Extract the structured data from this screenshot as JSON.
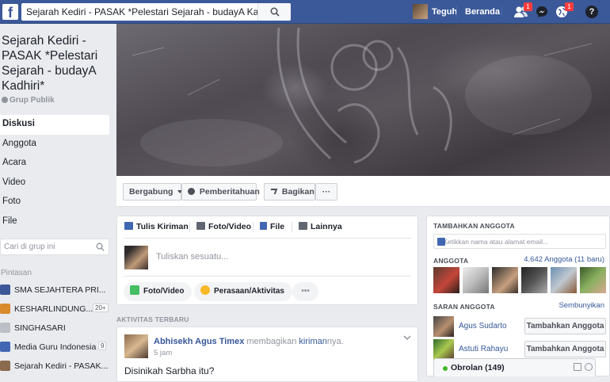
{
  "topbar": {
    "logo": "f",
    "search_value": "Sejarah Kediri - PASAK *Pelestari Sejarah - budayA Kadhiri*",
    "user_name": "Teguh",
    "home_label": "Beranda",
    "friend_requests_badge": "1",
    "notifications_badge": "1",
    "help_glyph": "?"
  },
  "sidebar": {
    "group_name": "Sejarah Kediri - PASAK *Pelestari Sejarah - budayA Kadhiri*",
    "group_privacy": "Grup Publik",
    "nav": [
      {
        "label": "Diskusi"
      },
      {
        "label": "Anggota"
      },
      {
        "label": "Acara"
      },
      {
        "label": "Video"
      },
      {
        "label": "Foto"
      },
      {
        "label": "File"
      }
    ],
    "search_placeholder": "Cari di grup ini",
    "shortcuts_title": "Pintasan",
    "shortcuts": [
      {
        "label": "SMA SEJAHTERA PRI...",
        "count": "",
        "icon": "group-icon",
        "color": "#3b5998"
      },
      {
        "label": "KESHARLINDUNG...",
        "count": "20+",
        "icon": "group-icon",
        "color": "#d98a2b"
      },
      {
        "label": "SINGHASARI",
        "count": "",
        "icon": "user-icon",
        "color": "#bcc0c6"
      },
      {
        "label": "Media Guru Indonesia",
        "count": "9",
        "icon": "book-icon",
        "color": "#4267b2"
      },
      {
        "label": "Sejarah Kediri - PASAK...",
        "count": "",
        "icon": "group-icon",
        "color": "#8a6b4e"
      }
    ]
  },
  "actions": {
    "join_label": "Bergabung",
    "notify_label": "Pemberitahuan",
    "share_label": "Bagikan",
    "more_label": "···"
  },
  "composer": {
    "tabs": [
      {
        "label": "Tulis Kiriman",
        "icon": "pencil-icon",
        "color": "#4267b2"
      },
      {
        "label": "Foto/Video",
        "icon": "camera-icon",
        "color": "#606770"
      },
      {
        "label": "File",
        "icon": "file-icon",
        "color": "#4267b2"
      },
      {
        "label": "Lainnya",
        "icon": "list-icon",
        "color": "#606770"
      }
    ],
    "placeholder": "Tuliskan sesuatu...",
    "buttons": [
      {
        "label": "Foto/Video",
        "color": "#45bd62"
      },
      {
        "label": "Perasaan/Aktivitas",
        "color": "#f7b928"
      }
    ],
    "more": "•••"
  },
  "activity": {
    "title": "AKTIVITAS TERBARU",
    "post": {
      "author": "Abhisekh Agus Timex",
      "verb": "membagikan",
      "object": "kiriman",
      "suffix": "nya.",
      "time": "5 jam",
      "text": "Disinikah Sarbha itu?"
    }
  },
  "right": {
    "add_title": "TAMBAHKAN ANGGOTA",
    "add_placeholder": "+ Ketikkan nama atau alamat email...",
    "members_title": "ANGGOTA",
    "members_count": "4.642 Anggota (11 baru)",
    "suggest_title": "SARAN ANGGOTA",
    "hide_label": "Sembunyikan",
    "suggestions": [
      {
        "name": "Agus Sudarto",
        "button": "Tambahkan Anggota"
      },
      {
        "name": "Astuti Rahayu",
        "button": "Tambahkan Anggota"
      }
    ]
  },
  "chat": {
    "label": "Obrolan (149)"
  }
}
